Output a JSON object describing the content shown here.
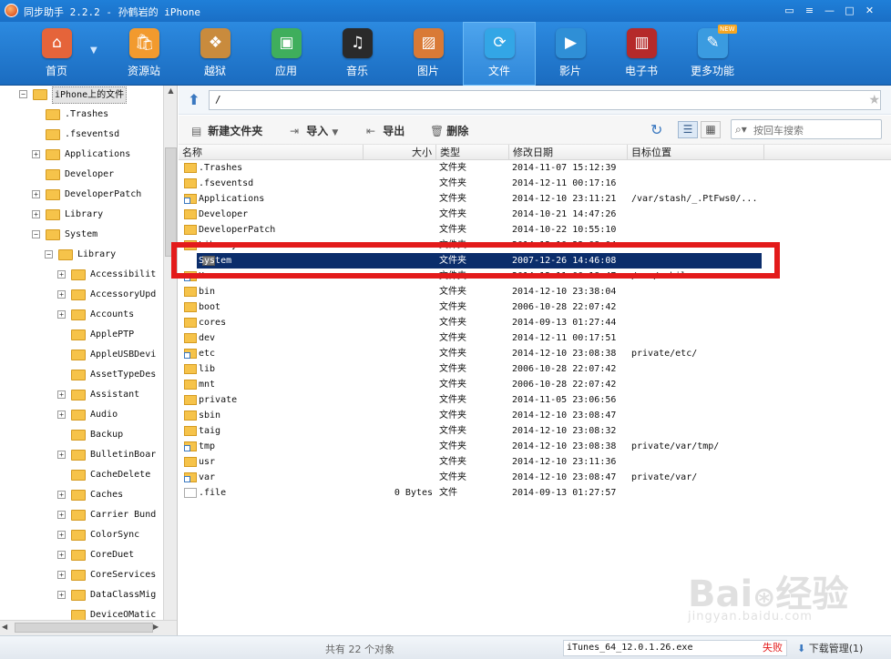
{
  "window": {
    "title": "同步助手 2.2.2 - 孙鹤岩的 iPhone",
    "controls": [
      "feedback-icon",
      "menu-icon",
      "minimize-icon",
      "maximize-icon",
      "close-icon"
    ]
  },
  "toolbar": {
    "items": [
      {
        "label": "首页",
        "icon": "home-icon",
        "color": "#e5643a"
      },
      {
        "label": "资源站",
        "icon": "store-icon",
        "color": "#f29a2e"
      },
      {
        "label": "越狱",
        "icon": "jailbreak-icon",
        "color": "#c98b3d"
      },
      {
        "label": "应用",
        "icon": "apps-icon",
        "color": "#3fae5c"
      },
      {
        "label": "音乐",
        "icon": "music-icon",
        "color": "#2a2a2a"
      },
      {
        "label": "图片",
        "icon": "photos-icon",
        "color": "#d97a36"
      },
      {
        "label": "文件",
        "icon": "files-icon",
        "color": "#33a6e6"
      },
      {
        "label": "影片",
        "icon": "video-icon",
        "color": "#2f8fd6"
      },
      {
        "label": "电子书",
        "icon": "ebook-icon",
        "color": "#b52a2a"
      },
      {
        "label": "更多功能",
        "icon": "more-tools-icon",
        "color": "#3a9be0",
        "badge": "NEW"
      }
    ],
    "active_index": 6
  },
  "tree": {
    "root": "iPhone上的文件",
    "items": [
      {
        "label": ".Trashes",
        "level": 1,
        "expandable": false
      },
      {
        "label": ".fseventsd",
        "level": 1,
        "expandable": false
      },
      {
        "label": "Applications",
        "level": 1,
        "expandable": true
      },
      {
        "label": "Developer",
        "level": 1,
        "expandable": false
      },
      {
        "label": "DeveloperPatch",
        "level": 1,
        "expandable": true
      },
      {
        "label": "Library",
        "level": 1,
        "expandable": true
      },
      {
        "label": "System",
        "level": 1,
        "expandable": true,
        "expanded": true
      },
      {
        "label": "Library",
        "level": 2,
        "expandable": true,
        "expanded": true
      },
      {
        "label": "Accessibilit",
        "level": 3,
        "expandable": true
      },
      {
        "label": "AccessoryUpd",
        "level": 3,
        "expandable": true
      },
      {
        "label": "Accounts",
        "level": 3,
        "expandable": true
      },
      {
        "label": "ApplePTP",
        "level": 3,
        "expandable": false
      },
      {
        "label": "AppleUSBDevi",
        "level": 3,
        "expandable": false
      },
      {
        "label": "AssetTypeDes",
        "level": 3,
        "expandable": false
      },
      {
        "label": "Assistant",
        "level": 3,
        "expandable": true
      },
      {
        "label": "Audio",
        "level": 3,
        "expandable": true
      },
      {
        "label": "Backup",
        "level": 3,
        "expandable": false
      },
      {
        "label": "BulletinBoar",
        "level": 3,
        "expandable": true
      },
      {
        "label": "CacheDelete",
        "level": 3,
        "expandable": false
      },
      {
        "label": "Caches",
        "level": 3,
        "expandable": true
      },
      {
        "label": "Carrier Bund",
        "level": 3,
        "expandable": true
      },
      {
        "label": "ColorSync",
        "level": 3,
        "expandable": true
      },
      {
        "label": "CoreDuet",
        "level": 3,
        "expandable": true
      },
      {
        "label": "CoreServices",
        "level": 3,
        "expandable": true
      },
      {
        "label": "DataClassMig",
        "level": 3,
        "expandable": true
      },
      {
        "label": "DeviceOMatic",
        "level": 3,
        "expandable": false
      }
    ]
  },
  "pathbar": {
    "path": "/"
  },
  "actions": {
    "new_folder": "新建文件夹",
    "import": "导入",
    "export": "导出",
    "delete": "删除",
    "search_placeholder": "按回车搜索"
  },
  "columns": {
    "name": "名称",
    "size": "大小",
    "type": "类型",
    "modified": "修改日期",
    "target": "目标位置"
  },
  "files": [
    {
      "name": ".Trashes",
      "size": "",
      "type": "文件夹",
      "modified": "2014-11-07 15:12:39",
      "target": "",
      "icon": "folder"
    },
    {
      "name": ".fseventsd",
      "size": "",
      "type": "文件夹",
      "modified": "2014-12-11 00:17:16",
      "target": "",
      "icon": "folder"
    },
    {
      "name": "Applications",
      "size": "",
      "type": "文件夹",
      "modified": "2014-12-10 23:11:21",
      "target": "/var/stash/_.PtFws0/...",
      "icon": "link"
    },
    {
      "name": "Developer",
      "size": "",
      "type": "文件夹",
      "modified": "2014-10-21 14:47:26",
      "target": "",
      "icon": "folder"
    },
    {
      "name": "DeveloperPatch",
      "size": "",
      "type": "文件夹",
      "modified": "2014-10-22 10:55:10",
      "target": "",
      "icon": "folder"
    },
    {
      "name": "Library",
      "size": "",
      "type": "文件夹",
      "modified": "2014-12-10 23:08:04",
      "target": "",
      "icon": "folder"
    },
    {
      "name": "System",
      "size": "",
      "type": "文件夹",
      "modified": "2007-12-26 14:46:08",
      "target": "",
      "icon": "folder",
      "selected": true
    },
    {
      "name": "User",
      "size": "",
      "type": "文件夹",
      "modified": "2014-12-11 00:18:47",
      "target": "/var/mobile",
      "icon": "link"
    },
    {
      "name": "bin",
      "size": "",
      "type": "文件夹",
      "modified": "2014-12-10 23:38:04",
      "target": "",
      "icon": "folder"
    },
    {
      "name": "boot",
      "size": "",
      "type": "文件夹",
      "modified": "2006-10-28 22:07:42",
      "target": "",
      "icon": "folder"
    },
    {
      "name": "cores",
      "size": "",
      "type": "文件夹",
      "modified": "2014-09-13 01:27:44",
      "target": "",
      "icon": "folder"
    },
    {
      "name": "dev",
      "size": "",
      "type": "文件夹",
      "modified": "2014-12-11 00:17:51",
      "target": "",
      "icon": "folder"
    },
    {
      "name": "etc",
      "size": "",
      "type": "文件夹",
      "modified": "2014-12-10 23:08:38",
      "target": "private/etc/",
      "icon": "link"
    },
    {
      "name": "lib",
      "size": "",
      "type": "文件夹",
      "modified": "2006-10-28 22:07:42",
      "target": "",
      "icon": "folder"
    },
    {
      "name": "mnt",
      "size": "",
      "type": "文件夹",
      "modified": "2006-10-28 22:07:42",
      "target": "",
      "icon": "folder"
    },
    {
      "name": "private",
      "size": "",
      "type": "文件夹",
      "modified": "2014-11-05 23:06:56",
      "target": "",
      "icon": "folder"
    },
    {
      "name": "sbin",
      "size": "",
      "type": "文件夹",
      "modified": "2014-12-10 23:08:47",
      "target": "",
      "icon": "folder"
    },
    {
      "name": "taig",
      "size": "",
      "type": "文件夹",
      "modified": "2014-12-10 23:08:32",
      "target": "",
      "icon": "folder"
    },
    {
      "name": "tmp",
      "size": "",
      "type": "文件夹",
      "modified": "2014-12-10 23:08:38",
      "target": "private/var/tmp/",
      "icon": "link"
    },
    {
      "name": "usr",
      "size": "",
      "type": "文件夹",
      "modified": "2014-12-10 23:11:36",
      "target": "",
      "icon": "folder"
    },
    {
      "name": "var",
      "size": "",
      "type": "文件夹",
      "modified": "2014-12-10 23:08:47",
      "target": "private/var/",
      "icon": "link"
    },
    {
      "name": ".file",
      "size": "0 Bytes",
      "type": "文件",
      "modified": "2014-09-13 01:27:57",
      "target": "",
      "icon": "doc"
    }
  ],
  "status": {
    "count_text": "共有 22 个对象",
    "download_file": "iTunes_64_12.0.1.26.exe",
    "download_state": "失败",
    "download_manager": "下载管理(1)"
  },
  "watermark": {
    "text": "Bai 经验",
    "sub": "jingyan.baidu.com"
  }
}
